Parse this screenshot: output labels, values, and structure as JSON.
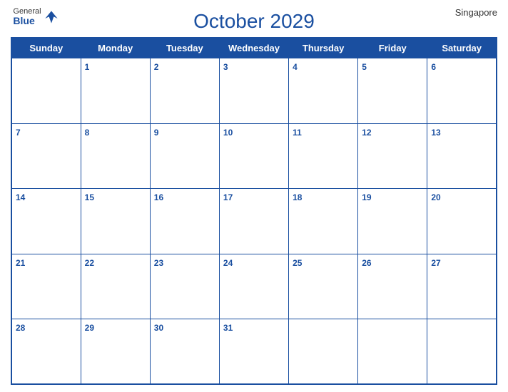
{
  "header": {
    "logo": {
      "general": "General",
      "blue": "Blue",
      "bird_color": "#1a4fa0"
    },
    "title": "October 2029",
    "country": "Singapore"
  },
  "calendar": {
    "days_of_week": [
      "Sunday",
      "Monday",
      "Tuesday",
      "Wednesday",
      "Thursday",
      "Friday",
      "Saturday"
    ],
    "weeks": [
      [
        "",
        "1",
        "2",
        "3",
        "4",
        "5",
        "6"
      ],
      [
        "7",
        "8",
        "9",
        "10",
        "11",
        "12",
        "13"
      ],
      [
        "14",
        "15",
        "16",
        "17",
        "18",
        "19",
        "20"
      ],
      [
        "21",
        "22",
        "23",
        "24",
        "25",
        "26",
        "27"
      ],
      [
        "28",
        "29",
        "30",
        "31",
        "",
        "",
        ""
      ]
    ]
  }
}
